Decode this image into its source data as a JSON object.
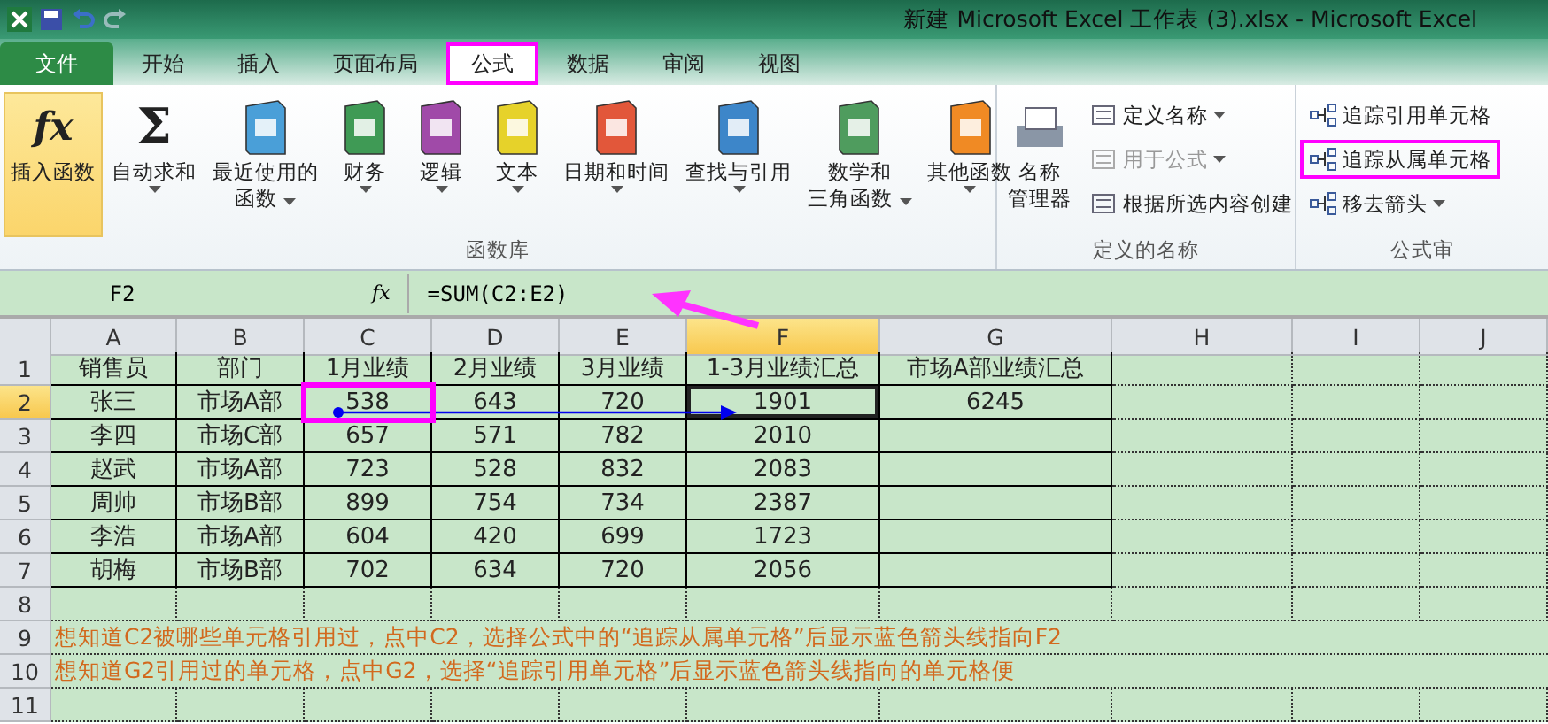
{
  "window": {
    "title": "新建 Microsoft Excel 工作表 (3).xlsx  -  Microsoft Excel"
  },
  "tabs": [
    {
      "label": "文件",
      "kind": "file",
      "selected": false,
      "highlighted": false
    },
    {
      "label": "开始",
      "kind": "tab",
      "selected": false,
      "highlighted": false
    },
    {
      "label": "插入",
      "kind": "tab",
      "selected": false,
      "highlighted": false
    },
    {
      "label": "页面布局",
      "kind": "tab",
      "selected": false,
      "highlighted": false
    },
    {
      "label": "公式",
      "kind": "tab",
      "selected": true,
      "highlighted": true
    },
    {
      "label": "数据",
      "kind": "tab",
      "selected": false,
      "highlighted": false
    },
    {
      "label": "审阅",
      "kind": "tab",
      "selected": false,
      "highlighted": false
    },
    {
      "label": "视图",
      "kind": "tab",
      "selected": false,
      "highlighted": false
    }
  ],
  "ribbon": {
    "function_library": {
      "title": "函数库",
      "buttons": [
        {
          "kind": "fx",
          "icon_text": "fx",
          "lines": [
            "插入函数"
          ],
          "dropdown": false,
          "selected": true
        },
        {
          "kind": "sigma",
          "icon_text": "Σ",
          "lines": [
            "自动求和"
          ],
          "dropdown": true,
          "selected": false
        },
        {
          "kind": "book",
          "color": "#4a9fd8",
          "lines": [
            "最近使用的",
            "函数"
          ],
          "dropdown": true,
          "selected": false
        },
        {
          "kind": "book",
          "color": "#3f9a55",
          "lines": [
            "财务"
          ],
          "dropdown": true,
          "selected": false
        },
        {
          "kind": "book",
          "color": "#a04aa8",
          "lines": [
            "逻辑"
          ],
          "dropdown": true,
          "selected": false
        },
        {
          "kind": "book",
          "color": "#e6d22a",
          "lines": [
            "文本"
          ],
          "dropdown": true,
          "selected": false
        },
        {
          "kind": "book",
          "color": "#e2573a",
          "lines": [
            "日期和时间"
          ],
          "dropdown": true,
          "selected": false
        },
        {
          "kind": "book",
          "color": "#3d86c9",
          "lines": [
            "查找与引用"
          ],
          "dropdown": true,
          "selected": false
        },
        {
          "kind": "book",
          "color": "#4f9c5e",
          "lines": [
            "数学和",
            "三角函数"
          ],
          "dropdown": true,
          "selected": false
        },
        {
          "kind": "book",
          "color": "#f08a24",
          "lines": [
            "其他函数"
          ],
          "dropdown": true,
          "selected": false
        }
      ]
    },
    "defined_names": {
      "title": "定义的名称",
      "manager": {
        "lines": [
          "名称",
          "管理器"
        ]
      },
      "items": [
        {
          "label": "定义名称",
          "dropdown": true,
          "disabled": false
        },
        {
          "label": "用于公式",
          "dropdown": true,
          "disabled": true
        },
        {
          "label": "根据所选内容创建",
          "dropdown": false,
          "disabled": false
        }
      ]
    },
    "formula_auditing": {
      "title": "公式审",
      "items": [
        {
          "label": "追踪引用单元格",
          "dropdown": false,
          "highlighted": false
        },
        {
          "label": "追踪从属单元格",
          "dropdown": false,
          "highlighted": true
        },
        {
          "label": "移去箭头",
          "dropdown": true,
          "highlighted": false
        }
      ]
    }
  },
  "formula_bar": {
    "name_box": "F2",
    "icon_text": "fx",
    "formula": "=SUM(C2:E2)"
  },
  "sheet": {
    "columns": [
      {
        "label": "A",
        "selected": false
      },
      {
        "label": "B",
        "selected": false
      },
      {
        "label": "C",
        "selected": false
      },
      {
        "label": "D",
        "selected": false
      },
      {
        "label": "E",
        "selected": false
      },
      {
        "label": "F",
        "selected": true
      },
      {
        "label": "G",
        "selected": false
      },
      {
        "label": "H",
        "selected": false
      },
      {
        "label": "I",
        "selected": false
      },
      {
        "label": "J",
        "selected": false
      }
    ],
    "rows": [
      {
        "label": "1",
        "selected": false,
        "cells": [
          {
            "text": "销售员",
            "selected": false,
            "highlighted": false
          },
          {
            "text": "部门",
            "selected": false,
            "highlighted": false
          },
          {
            "text": "1月业绩",
            "selected": false,
            "highlighted": false
          },
          {
            "text": "2月业绩",
            "selected": false,
            "highlighted": false
          },
          {
            "text": "3月业绩",
            "selected": false,
            "highlighted": false
          },
          {
            "text": "1-3月业绩汇总",
            "selected": false,
            "highlighted": false
          },
          {
            "text": "市场A部业绩汇总",
            "selected": false,
            "highlighted": false
          }
        ]
      },
      {
        "label": "2",
        "selected": true,
        "cells": [
          {
            "text": "张三",
            "selected": false,
            "highlighted": false
          },
          {
            "text": "市场A部",
            "selected": false,
            "highlighted": false
          },
          {
            "text": "538",
            "selected": false,
            "highlighted": true
          },
          {
            "text": "643",
            "selected": false,
            "highlighted": false
          },
          {
            "text": "720",
            "selected": false,
            "highlighted": false
          },
          {
            "text": "1901",
            "selected": true,
            "highlighted": false
          },
          {
            "text": "6245",
            "selected": false,
            "highlighted": false
          }
        ]
      },
      {
        "label": "3",
        "selected": false,
        "cells": [
          {
            "text": "李四",
            "selected": false,
            "highlighted": false
          },
          {
            "text": "市场C部",
            "selected": false,
            "highlighted": false
          },
          {
            "text": "657",
            "selected": false,
            "highlighted": false
          },
          {
            "text": "571",
            "selected": false,
            "highlighted": false
          },
          {
            "text": "782",
            "selected": false,
            "highlighted": false
          },
          {
            "text": "2010",
            "selected": false,
            "highlighted": false
          }
        ]
      },
      {
        "label": "4",
        "selected": false,
        "cells": [
          {
            "text": "赵武",
            "selected": false,
            "highlighted": false
          },
          {
            "text": "市场A部",
            "selected": false,
            "highlighted": false
          },
          {
            "text": "723",
            "selected": false,
            "highlighted": false
          },
          {
            "text": "528",
            "selected": false,
            "highlighted": false
          },
          {
            "text": "832",
            "selected": false,
            "highlighted": false
          },
          {
            "text": "2083",
            "selected": false,
            "highlighted": false
          }
        ]
      },
      {
        "label": "5",
        "selected": false,
        "cells": [
          {
            "text": "周帅",
            "selected": false,
            "highlighted": false
          },
          {
            "text": "市场B部",
            "selected": false,
            "highlighted": false
          },
          {
            "text": "899",
            "selected": false,
            "highlighted": false
          },
          {
            "text": "754",
            "selected": false,
            "highlighted": false
          },
          {
            "text": "734",
            "selected": false,
            "highlighted": false
          },
          {
            "text": "2387",
            "selected": false,
            "highlighted": false
          }
        ]
      },
      {
        "label": "6",
        "selected": false,
        "cells": [
          {
            "text": "李浩",
            "selected": false,
            "highlighted": false
          },
          {
            "text": "市场A部",
            "selected": false,
            "highlighted": false
          },
          {
            "text": "604",
            "selected": false,
            "highlighted": false
          },
          {
            "text": "420",
            "selected": false,
            "highlighted": false
          },
          {
            "text": "699",
            "selected": false,
            "highlighted": false
          },
          {
            "text": "1723",
            "selected": false,
            "highlighted": false
          }
        ]
      },
      {
        "label": "7",
        "selected": false,
        "cells": [
          {
            "text": "胡梅",
            "selected": false,
            "highlighted": false
          },
          {
            "text": "市场B部",
            "selected": false,
            "highlighted": false
          },
          {
            "text": "702",
            "selected": false,
            "highlighted": false
          },
          {
            "text": "634",
            "selected": false,
            "highlighted": false
          },
          {
            "text": "720",
            "selected": false,
            "highlighted": false
          },
          {
            "text": "2056",
            "selected": false,
            "highlighted": false
          }
        ]
      },
      {
        "label": "8",
        "selected": false
      },
      {
        "label": "9",
        "selected": false,
        "note": "想知道C2被哪些单元格引用过，点中C2，选择公式中的“追踪从属单元格”后显示蓝色箭头线指向F2"
      },
      {
        "label": "10",
        "selected": false,
        "note": "想知道G2引用过的单元格，点中G2，选择“追踪引用单元格”后显示蓝色箭头线指向的单元格便"
      },
      {
        "label": "11",
        "selected": false
      }
    ]
  }
}
